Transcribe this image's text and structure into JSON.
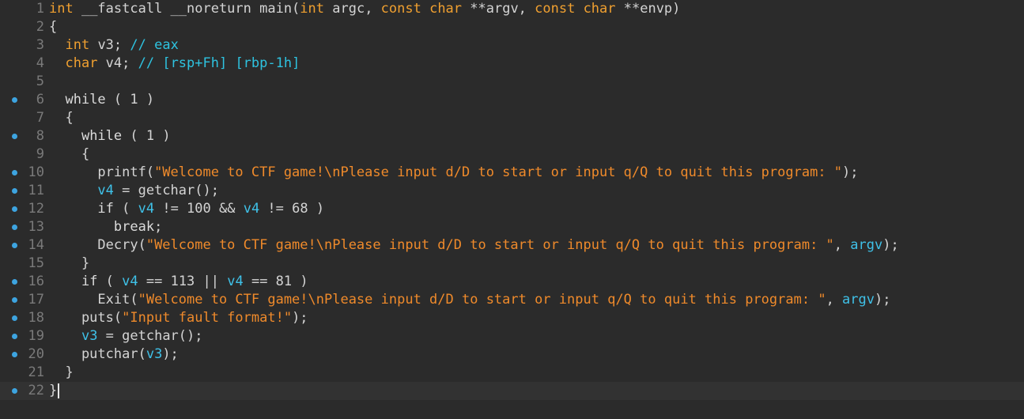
{
  "colors": {
    "background": "#2b2b2b",
    "current_line": "#323232",
    "line_number": "#7a7a7a",
    "breakpoint": "#3da4e0",
    "keyword": "#dcdcdc",
    "type": "#f0a030",
    "variable": "#3fc1e8",
    "comment": "#2ec3e0",
    "string": "#ef8a2b"
  },
  "editor": {
    "current_line": 22,
    "lines": [
      {
        "n": "1",
        "bp": false,
        "tokens": [
          [
            "type",
            "int"
          ],
          [
            "plain",
            " __fastcall __noreturn main("
          ],
          [
            "type",
            "int"
          ],
          [
            "plain",
            " argc, "
          ],
          [
            "type",
            "const char"
          ],
          [
            "plain",
            " **argv, "
          ],
          [
            "type",
            "const char"
          ],
          [
            "plain",
            " **envp)"
          ]
        ]
      },
      {
        "n": "2",
        "bp": false,
        "tokens": [
          [
            "plain",
            "{"
          ]
        ]
      },
      {
        "n": "3",
        "bp": false,
        "tokens": [
          [
            "plain",
            "  "
          ],
          [
            "type",
            "int"
          ],
          [
            "plain",
            " v3; "
          ],
          [
            "comment",
            "// eax"
          ]
        ]
      },
      {
        "n": "4",
        "bp": false,
        "tokens": [
          [
            "plain",
            "  "
          ],
          [
            "type",
            "char"
          ],
          [
            "plain",
            " v4; "
          ],
          [
            "comment",
            "// [rsp+Fh] [rbp-1h]"
          ]
        ]
      },
      {
        "n": "5",
        "bp": false,
        "tokens": [
          [
            "plain",
            ""
          ]
        ]
      },
      {
        "n": "6",
        "bp": true,
        "tokens": [
          [
            "plain",
            "  "
          ],
          [
            "kw",
            "while"
          ],
          [
            "plain",
            " ( 1 )"
          ]
        ]
      },
      {
        "n": "7",
        "bp": false,
        "tokens": [
          [
            "plain",
            "  {"
          ]
        ]
      },
      {
        "n": "8",
        "bp": true,
        "tokens": [
          [
            "plain",
            "    "
          ],
          [
            "kw",
            "while"
          ],
          [
            "plain",
            " ( 1 )"
          ]
        ]
      },
      {
        "n": "9",
        "bp": false,
        "tokens": [
          [
            "plain",
            "    {"
          ]
        ]
      },
      {
        "n": "10",
        "bp": true,
        "tokens": [
          [
            "plain",
            "      printf("
          ],
          [
            "str",
            "\"Welcome to CTF game!\\nPlease input d/D to start or input q/Q to quit this program: \""
          ],
          [
            "plain",
            ");"
          ]
        ]
      },
      {
        "n": "11",
        "bp": true,
        "tokens": [
          [
            "plain",
            "      "
          ],
          [
            "var",
            "v4"
          ],
          [
            "plain",
            " = getchar();"
          ]
        ]
      },
      {
        "n": "12",
        "bp": true,
        "tokens": [
          [
            "plain",
            "      "
          ],
          [
            "kw",
            "if"
          ],
          [
            "plain",
            " ( "
          ],
          [
            "var",
            "v4"
          ],
          [
            "plain",
            " != 100 && "
          ],
          [
            "var",
            "v4"
          ],
          [
            "plain",
            " != 68 )"
          ]
        ]
      },
      {
        "n": "13",
        "bp": true,
        "tokens": [
          [
            "plain",
            "        "
          ],
          [
            "kw",
            "break"
          ],
          [
            "plain",
            ";"
          ]
        ]
      },
      {
        "n": "14",
        "bp": true,
        "tokens": [
          [
            "plain",
            "      Decry("
          ],
          [
            "str",
            "\"Welcome to CTF game!\\nPlease input d/D to start or input q/Q to quit this program: \""
          ],
          [
            "plain",
            ", "
          ],
          [
            "var",
            "argv"
          ],
          [
            "plain",
            ");"
          ]
        ]
      },
      {
        "n": "15",
        "bp": false,
        "tokens": [
          [
            "plain",
            "    }"
          ]
        ]
      },
      {
        "n": "16",
        "bp": true,
        "tokens": [
          [
            "plain",
            "    "
          ],
          [
            "kw",
            "if"
          ],
          [
            "plain",
            " ( "
          ],
          [
            "var",
            "v4"
          ],
          [
            "plain",
            " == 113 || "
          ],
          [
            "var",
            "v4"
          ],
          [
            "plain",
            " == 81 )"
          ]
        ]
      },
      {
        "n": "17",
        "bp": true,
        "tokens": [
          [
            "plain",
            "      Exit("
          ],
          [
            "str",
            "\"Welcome to CTF game!\\nPlease input d/D to start or input q/Q to quit this program: \""
          ],
          [
            "plain",
            ", "
          ],
          [
            "var",
            "argv"
          ],
          [
            "plain",
            ");"
          ]
        ]
      },
      {
        "n": "18",
        "bp": true,
        "tokens": [
          [
            "plain",
            "    puts("
          ],
          [
            "str",
            "\"Input fault format!\""
          ],
          [
            "plain",
            ");"
          ]
        ]
      },
      {
        "n": "19",
        "bp": true,
        "tokens": [
          [
            "plain",
            "    "
          ],
          [
            "var",
            "v3"
          ],
          [
            "plain",
            " = getchar();"
          ]
        ]
      },
      {
        "n": "20",
        "bp": true,
        "tokens": [
          [
            "plain",
            "    putchar("
          ],
          [
            "var",
            "v3"
          ],
          [
            "plain",
            ");"
          ]
        ]
      },
      {
        "n": "21",
        "bp": false,
        "tokens": [
          [
            "plain",
            "  }"
          ]
        ]
      },
      {
        "n": "22",
        "bp": true,
        "tokens": [
          [
            "plain",
            "}"
          ]
        ]
      }
    ]
  }
}
